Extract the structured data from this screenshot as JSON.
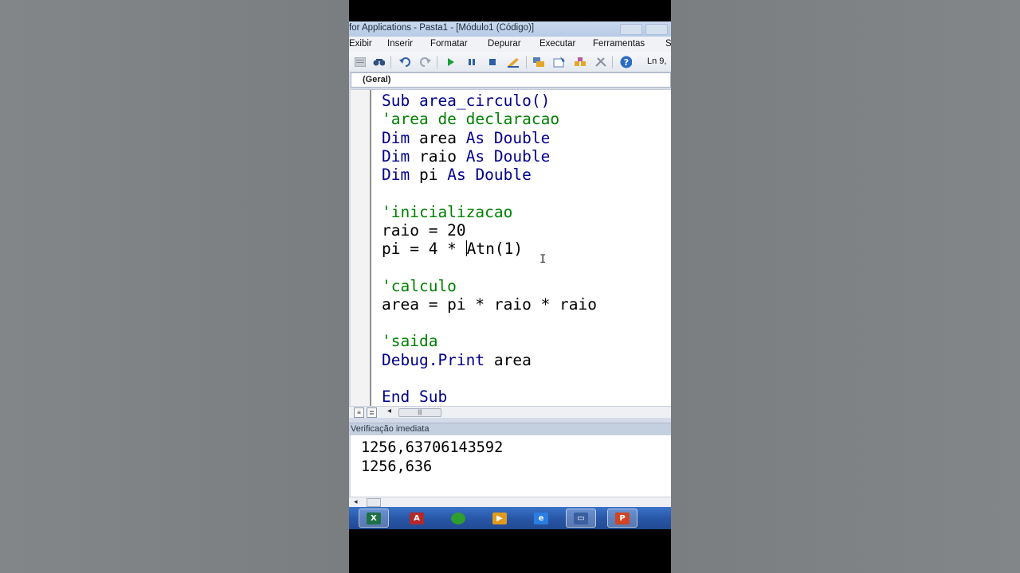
{
  "window": {
    "title": "for Applications - Pasta1 - [Módulo1 (Código)]"
  },
  "menu": [
    "Exibir",
    "Inserir",
    "Formatar",
    "Depurar",
    "Executar",
    "Ferramentas",
    "S"
  ],
  "toolbar": {
    "icons": [
      "excel-icon",
      "find-icon",
      "undo-icon",
      "redo-icon",
      "run-icon",
      "break-icon",
      "reset-icon",
      "design-mode-icon",
      "project-explorer-icon",
      "properties-icon",
      "object-browser-icon",
      "toolbox-icon",
      "help-icon"
    ],
    "cursor_position": "Ln 9,"
  },
  "combo": {
    "selected": "(Geral)"
  },
  "code": {
    "lines": [
      {
        "parts": [
          {
            "t": "Sub area_circulo()",
            "c": "kw"
          }
        ]
      },
      {
        "parts": [
          {
            "t": "'area de declaracao",
            "c": "cm"
          }
        ]
      },
      {
        "parts": [
          {
            "t": "Dim",
            "c": "kw"
          },
          {
            "t": " area ",
            "c": ""
          },
          {
            "t": "As",
            "c": "kw"
          },
          {
            "t": " ",
            "c": ""
          },
          {
            "t": "Double",
            "c": "kw"
          }
        ]
      },
      {
        "parts": [
          {
            "t": "Dim",
            "c": "kw"
          },
          {
            "t": " raio ",
            "c": ""
          },
          {
            "t": "As",
            "c": "kw"
          },
          {
            "t": " ",
            "c": ""
          },
          {
            "t": "Double",
            "c": "kw"
          }
        ]
      },
      {
        "parts": [
          {
            "t": "Dim",
            "c": "kw"
          },
          {
            "t": " pi ",
            "c": ""
          },
          {
            "t": "As",
            "c": "kw"
          },
          {
            "t": " ",
            "c": ""
          },
          {
            "t": "Double",
            "c": "kw"
          }
        ]
      },
      {
        "parts": []
      },
      {
        "parts": [
          {
            "t": "'inicializacao",
            "c": "cm"
          }
        ]
      },
      {
        "parts": [
          {
            "t": "raio = 20",
            "c": ""
          }
        ]
      },
      {
        "parts": [
          {
            "t": "pi = 4 * ",
            "c": ""
          },
          {
            "t": "",
            "c": "caret"
          },
          {
            "t": "Atn(1)",
            "c": ""
          }
        ]
      },
      {
        "parts": []
      },
      {
        "parts": [
          {
            "t": "'calculo",
            "c": "cm"
          }
        ]
      },
      {
        "parts": [
          {
            "t": "area = pi * raio * raio",
            "c": ""
          }
        ]
      },
      {
        "parts": []
      },
      {
        "parts": [
          {
            "t": "'saida",
            "c": "cm"
          }
        ]
      },
      {
        "parts": [
          {
            "t": "Debug.Print",
            "c": "kw"
          },
          {
            "t": " area",
            "c": ""
          }
        ]
      },
      {
        "parts": []
      },
      {
        "parts": [
          {
            "t": "End Sub",
            "c": "kw"
          }
        ]
      }
    ]
  },
  "immediate": {
    "title": "Verificação imediata",
    "lines": [
      "1256,63706143592",
      "1256,636"
    ]
  },
  "taskbar": {
    "apps": [
      {
        "name": "excel-taskbar-button",
        "letter": "X",
        "color": "#1e7145",
        "active": true
      },
      {
        "name": "access-taskbar-button",
        "letter": "A",
        "color": "#b22a2a",
        "active": false
      },
      {
        "name": "green-app-taskbar-button",
        "letter": "",
        "color": "#2e9e2e",
        "active": false
      },
      {
        "name": "media-player-taskbar-button",
        "letter": "▶",
        "color": "#e09a1e",
        "active": false
      },
      {
        "name": "internet-explorer-taskbar-button",
        "letter": "e",
        "color": "#2a7de1",
        "active": false
      },
      {
        "name": "remote-desktop-taskbar-button",
        "letter": "▭",
        "color": "#3a5fa0",
        "active": true
      },
      {
        "name": "powerpoint-taskbar-button",
        "letter": "P",
        "color": "#d04423",
        "active": true
      }
    ]
  }
}
